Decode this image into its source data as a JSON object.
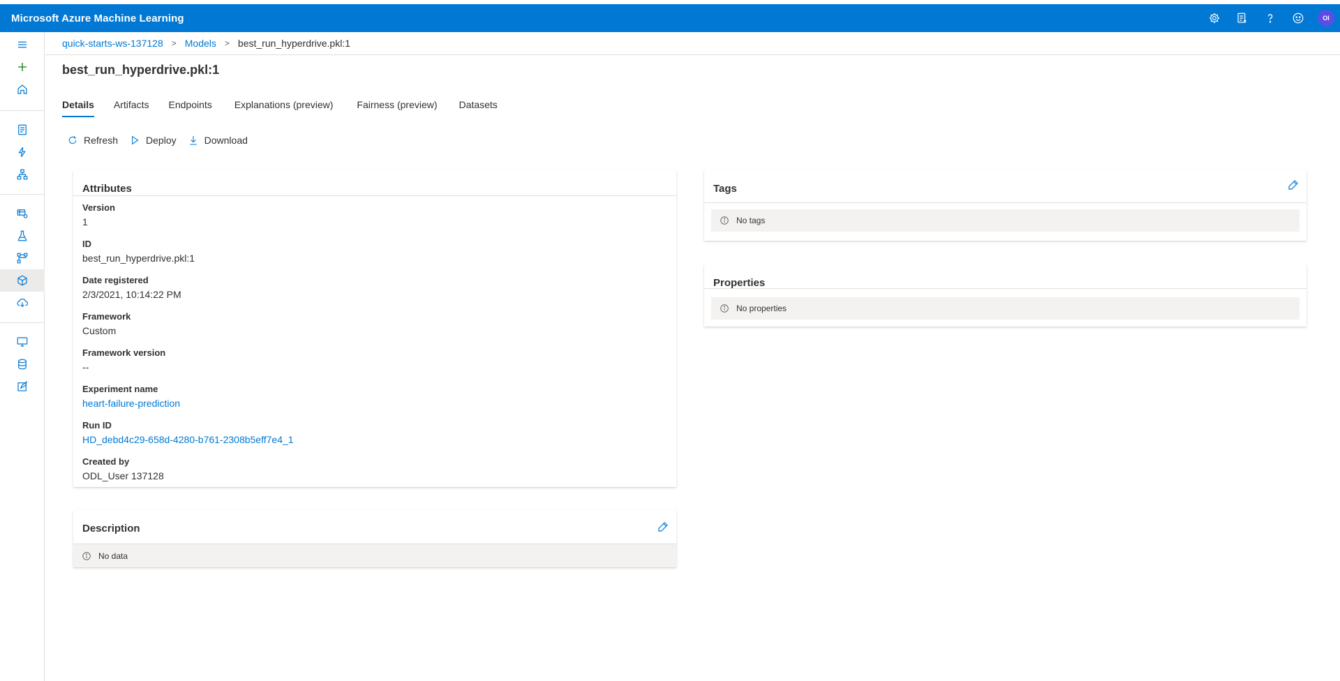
{
  "app": {
    "title": "Microsoft Azure Machine Learning",
    "user_initials": "OI"
  },
  "topbar": {
    "icons": [
      "gear-icon",
      "feedback-list-icon",
      "help-icon",
      "smiley-icon"
    ]
  },
  "leftnav": {
    "icons": [
      "hamburger-icon",
      "plus-icon",
      "home-icon",
      "notebook-icon",
      "automl-icon",
      "designer-icon",
      "datasets-icon",
      "experiments-icon",
      "pipelines-icon",
      "models-icon",
      "endpoints-icon",
      "compute-icon",
      "datastores-icon",
      "labeling-icon"
    ],
    "active": "models-icon"
  },
  "breadcrumb": {
    "workspace": "quick-starts-ws-137128",
    "section": "Models",
    "current": "best_run_hyperdrive.pkl:1"
  },
  "page": {
    "title": "best_run_hyperdrive.pkl:1"
  },
  "tabs": [
    {
      "label": "Details",
      "active": true
    },
    {
      "label": "Artifacts"
    },
    {
      "label": "Endpoints"
    },
    {
      "label": "Explanations (preview)"
    },
    {
      "label": "Fairness (preview)"
    },
    {
      "label": "Datasets"
    }
  ],
  "toolbar": {
    "refresh": "Refresh",
    "deploy": "Deploy",
    "download": "Download"
  },
  "attributes": {
    "title": "Attributes",
    "version_label": "Version",
    "version": "1",
    "id_label": "ID",
    "id": "best_run_hyperdrive.pkl:1",
    "date_label": "Date registered",
    "date": "2/3/2021, 10:14:22 PM",
    "framework_label": "Framework",
    "framework": "Custom",
    "framework_version_label": "Framework version",
    "framework_version": "--",
    "experiment_label": "Experiment name",
    "experiment": "heart-failure-prediction",
    "run_id_label": "Run ID",
    "run_id": "HD_debd4c29-658d-4280-b761-2308b5eff7e4_1",
    "created_by_label": "Created by",
    "created_by": "ODL_User 137128"
  },
  "description": {
    "title": "Description",
    "empty": "No data"
  },
  "tags": {
    "title": "Tags",
    "empty": "No tags"
  },
  "properties": {
    "title": "Properties",
    "empty": "No properties"
  },
  "colors": {
    "accent": "#0078d4",
    "avatar": "#5c4ee5",
    "text": "#323130"
  }
}
